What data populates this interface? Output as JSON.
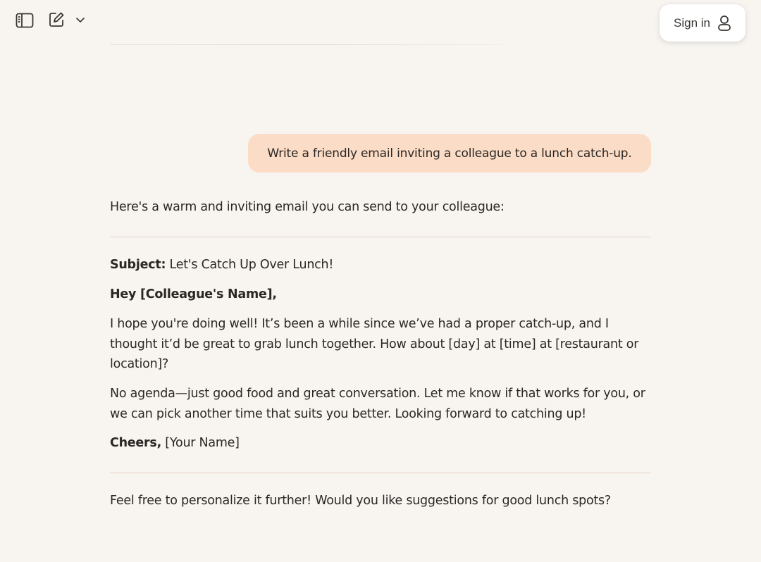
{
  "header": {
    "sign_in_label": "Sign in",
    "icons": {
      "sidebar": "sidebar-toggle-icon",
      "compose": "compose-icon",
      "chevron": "chevron-down-icon",
      "user": "user-icon"
    }
  },
  "conversation": {
    "user_message": "Write a friendly email inviting a colleague to a lunch catch-up.",
    "assistant": {
      "intro": "Here's a warm and inviting email you can send to your colleague:",
      "subject_label": "Subject:",
      "subject_text": " Let's Catch Up Over Lunch!",
      "greeting": "Hey [Colleague's Name],",
      "para1": "I hope you're doing well! It’s been a while since we’ve had a proper catch-up, and I thought it’d be great to grab lunch together. How about [day] at [time] at [restaurant or location]?",
      "para2": "No agenda—just good food and great conversation. Let me know if that works for you, or we can pick another time that suits you better. Looking forward to catching up!",
      "signoff_label": "Cheers,",
      "signoff_text": " [Your Name]",
      "outro": "Feel free to personalize it further! Would you like suggestions for good lunch spots?"
    }
  },
  "colors": {
    "background": "#f8f5f1",
    "user_bubble": "#fbdcc6",
    "divider": "#e7d3c6",
    "text": "#2b2724"
  }
}
